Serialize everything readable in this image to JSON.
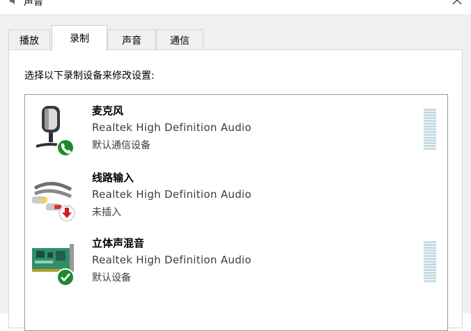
{
  "window": {
    "title": "声音"
  },
  "tabs": [
    {
      "label": "播放"
    },
    {
      "label": "录制"
    },
    {
      "label": "声音"
    },
    {
      "label": "通信"
    }
  ],
  "instruction": "选择以下录制设备来修改设置:",
  "devices": [
    {
      "name": "麦克风",
      "driver": "Realtek High Definition Audio",
      "status": "默认通信设备",
      "icon": "microphone-icon",
      "badge": "phone-badge-icon",
      "meter": true
    },
    {
      "name": "线路输入",
      "driver": "Realtek High Definition Audio",
      "status": "未插入",
      "icon": "line-in-cable-icon",
      "badge": "unplugged-arrow-icon",
      "meter": false
    },
    {
      "name": "立体声混音",
      "driver": "Realtek High Definition Audio",
      "status": "默认设备",
      "icon": "sound-card-icon",
      "badge": "default-check-icon",
      "meter": true
    }
  ],
  "colors": {
    "badge_green": "#1e8a2f",
    "badge_red": "#d02020",
    "meter": "#c6dbe3"
  }
}
